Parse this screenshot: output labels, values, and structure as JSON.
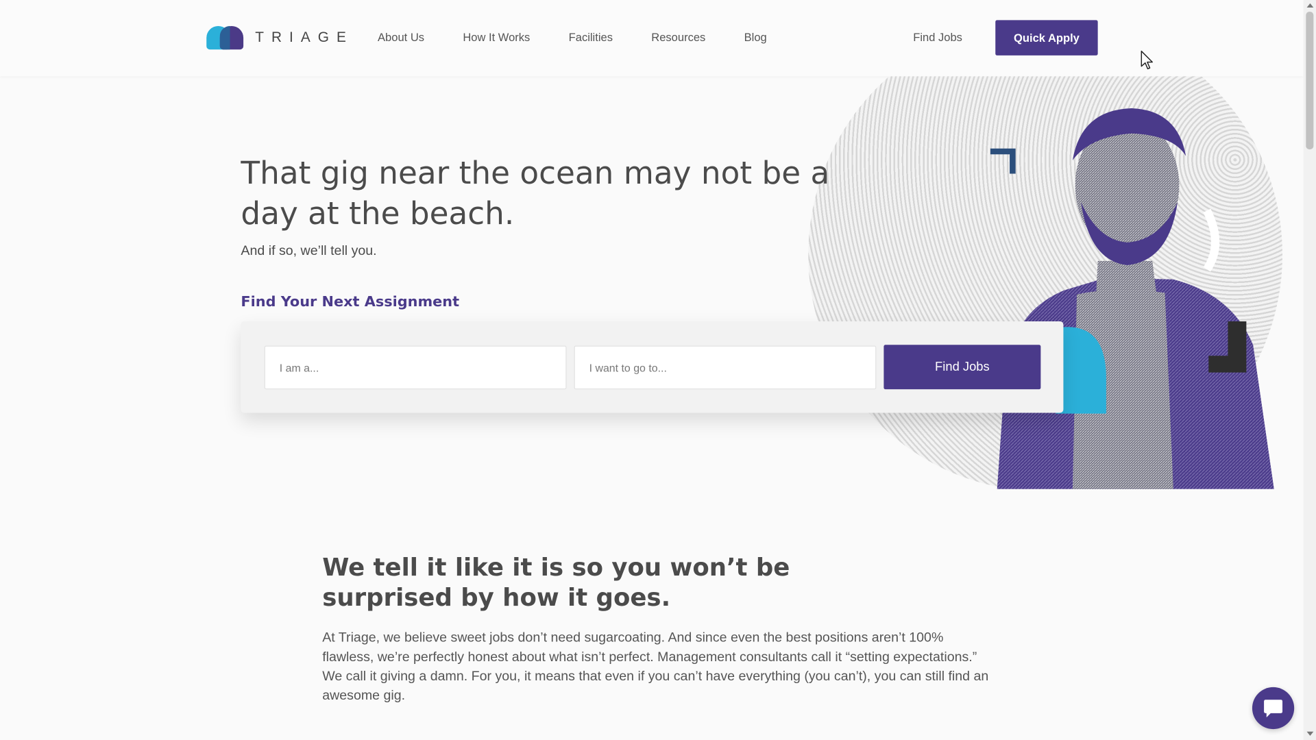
{
  "header": {
    "logo_text": "TRIAGE",
    "nav": [
      "About Us",
      "How It Works",
      "Facilities",
      "Resources",
      "Blog"
    ],
    "find_jobs_label": "Find Jobs",
    "quick_apply_label": "Quick Apply"
  },
  "hero": {
    "title": "That gig near the ocean may not be a day at the beach.",
    "subtitle": "And if so, we’ll tell you.",
    "search_heading": "Find Your Next Assignment",
    "role_placeholder": "I am a...",
    "destination_placeholder": "I want to go to...",
    "search_button": "Find Jobs"
  },
  "about": {
    "title": "We tell it like it is so you won’t be surprised by how it goes.",
    "body": "At Triage, we believe sweet jobs don’t need sugarcoating. And since even the best positions aren’t 100% flawless, we’re perfectly honest about what isn’t perfect. Management consultants call it “setting expectations.” We call it giving a damn. For you, it means that even if you can’t have everything (you can’t), you can still find an awesome gig."
  },
  "colors": {
    "brand_purple": "#4a3a8a",
    "brand_cyan": "#2bb0d9",
    "background": "#fafafa"
  },
  "icons": {
    "chat": "chat-bubble-icon",
    "cursor": "mouse-pointer-icon"
  }
}
